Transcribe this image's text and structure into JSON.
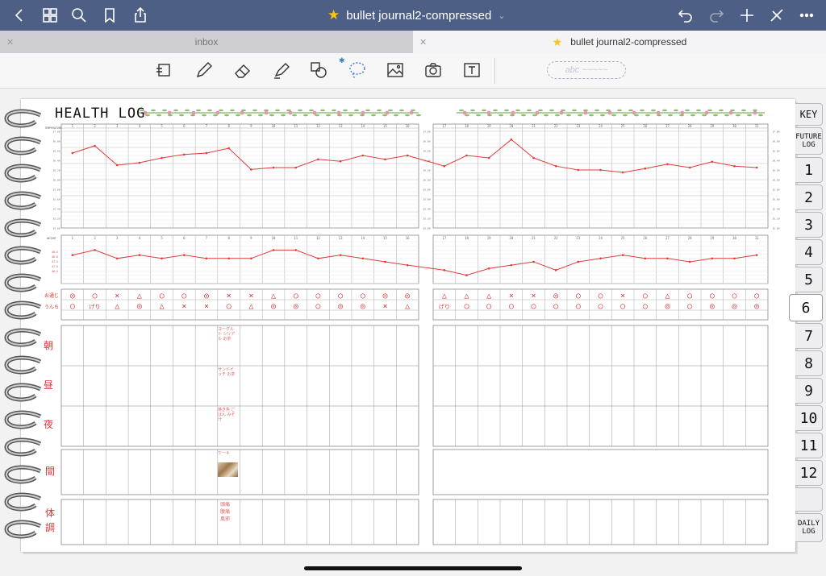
{
  "top_bar": {
    "document_title": "bullet journal2-compressed",
    "icons": [
      "back-icon",
      "grid-icon",
      "search-icon",
      "bookmark-icon",
      "share-icon",
      "undo-icon",
      "redo-icon",
      "add-page-icon",
      "close-edit-icon",
      "more-icon"
    ]
  },
  "tabs": [
    {
      "label": "inbox",
      "active": false
    },
    {
      "label": "bullet journal2-compressed",
      "active": true
    }
  ],
  "toolbar": {
    "tools": [
      "reader-icon",
      "pen-icon",
      "eraser-icon",
      "highlighter-icon",
      "shapes-icon",
      "lasso-icon",
      "image-icon",
      "camera-icon",
      "textbox-icon"
    ],
    "handwriting_placeholder": "abc ~~~~~"
  },
  "page": {
    "title": "HEALTH LOG",
    "section_temperature": "TEMPERATURE",
    "section_weight": "WEIGHT",
    "days_left": [
      "1",
      "2",
      "3",
      "4",
      "5",
      "6",
      "7",
      "8",
      "9",
      "10",
      "11",
      "12",
      "13",
      "14",
      "15",
      "16"
    ],
    "days_right": [
      "17",
      "18",
      "19",
      "20",
      "21",
      "22",
      "23",
      "24",
      "25",
      "26",
      "27",
      "28",
      "29",
      "30",
      "31"
    ],
    "temp_scale": [
      "37.00",
      "36.80",
      "36.60",
      "36.40",
      "36.20",
      "36.00",
      "35.80",
      "35.60",
      "35.40",
      "35.20",
      "35.00"
    ],
    "weight_scale": [
      "48.5",
      "48.0",
      "47.5",
      "47.0",
      "46.5"
    ],
    "row_labels": {
      "row1": "お通じ",
      "row2": "うんち",
      "morning": "朝",
      "noon": "昼",
      "night": "夜",
      "snack": "間",
      "condition_1": "体",
      "condition_2": "調"
    },
    "symbols_row1": [
      "◎",
      "○",
      "×",
      "△",
      "○",
      "○",
      "◎",
      "×",
      "×",
      "△",
      "○",
      "○",
      "○",
      "○",
      "◎",
      "◎",
      "△",
      "△",
      "△",
      "×",
      "×",
      "◎",
      "○",
      "○",
      "×",
      "○",
      "△",
      "○",
      "○",
      "○",
      "○"
    ],
    "symbols_row2": [
      "○",
      "げり",
      "△",
      "◎",
      "△",
      "×",
      "×",
      "○",
      "△",
      "◎",
      "◎",
      "○",
      "◎",
      "◎",
      "×",
      "△",
      "げり",
      "○",
      "○",
      "○",
      "○",
      "○",
      "○",
      "○",
      "○",
      "○",
      "◎",
      "○",
      "◎",
      "◎",
      "◎"
    ],
    "notes": {
      "morning": "ヨーグルト シリアル お茶",
      "noon": "サンドイッチ お茶",
      "night": "焼き魚 ごはん みそ汁",
      "snack": "ケーキ",
      "condition": "頭痛 腹痛 風邪"
    }
  },
  "side_tabs": [
    {
      "label": "KEY"
    },
    {
      "label": "FUTURE LOG"
    },
    {
      "label": "1"
    },
    {
      "label": "2"
    },
    {
      "label": "3"
    },
    {
      "label": "4"
    },
    {
      "label": "5"
    },
    {
      "label": "6",
      "active": true
    },
    {
      "label": "7"
    },
    {
      "label": "8"
    },
    {
      "label": "9"
    },
    {
      "label": "10"
    },
    {
      "label": "11"
    },
    {
      "label": "12"
    },
    {
      "label": ""
    },
    {
      "label": "DAILY LOG"
    }
  ],
  "chart_data": [
    {
      "type": "line",
      "xlabel": "day",
      "ylabel": "TEMPERATURE",
      "x": [
        1,
        2,
        3,
        4,
        5,
        6,
        7,
        8,
        9,
        10,
        11,
        12,
        13,
        14,
        15,
        16,
        17,
        18,
        19,
        20,
        21,
        22,
        23,
        24,
        25,
        26,
        27,
        28,
        29,
        30,
        31
      ],
      "values": [
        36.55,
        36.7,
        36.3,
        36.35,
        36.45,
        36.52,
        36.55,
        36.65,
        36.21,
        36.25,
        36.25,
        36.42,
        36.38,
        36.5,
        36.42,
        36.5,
        36.28,
        36.5,
        36.45,
        36.83,
        36.45,
        36.28,
        36.2,
        36.2,
        36.15,
        36.23,
        36.32,
        36.25,
        36.37,
        36.28,
        36.25
      ],
      "ylim": [
        35.0,
        37.0
      ]
    },
    {
      "type": "line",
      "xlabel": "day",
      "ylabel": "WEIGHT",
      "x": [
        1,
        2,
        3,
        4,
        5,
        6,
        7,
        8,
        9,
        10,
        11,
        12,
        13,
        14,
        15,
        16,
        17,
        18,
        19,
        20,
        21,
        22,
        23,
        24,
        25,
        26,
        27,
        28,
        29,
        30,
        31
      ],
      "values": [
        48.2,
        48.5,
        48.0,
        48.2,
        48.0,
        48.2,
        48.0,
        48.0,
        48.0,
        48.5,
        48.5,
        48.0,
        48.2,
        48.0,
        47.8,
        47.6,
        47.3,
        47.0,
        47.4,
        47.6,
        47.8,
        47.3,
        47.8,
        48.0,
        48.2,
        48.0,
        48.0,
        47.8,
        48.0,
        48.0,
        48.2
      ],
      "ylim": [
        46.5,
        49.0
      ]
    }
  ],
  "colors": {
    "top_bar": "#4e5f86",
    "plot_line": "#e23b3b",
    "accent_red": "#d33"
  }
}
